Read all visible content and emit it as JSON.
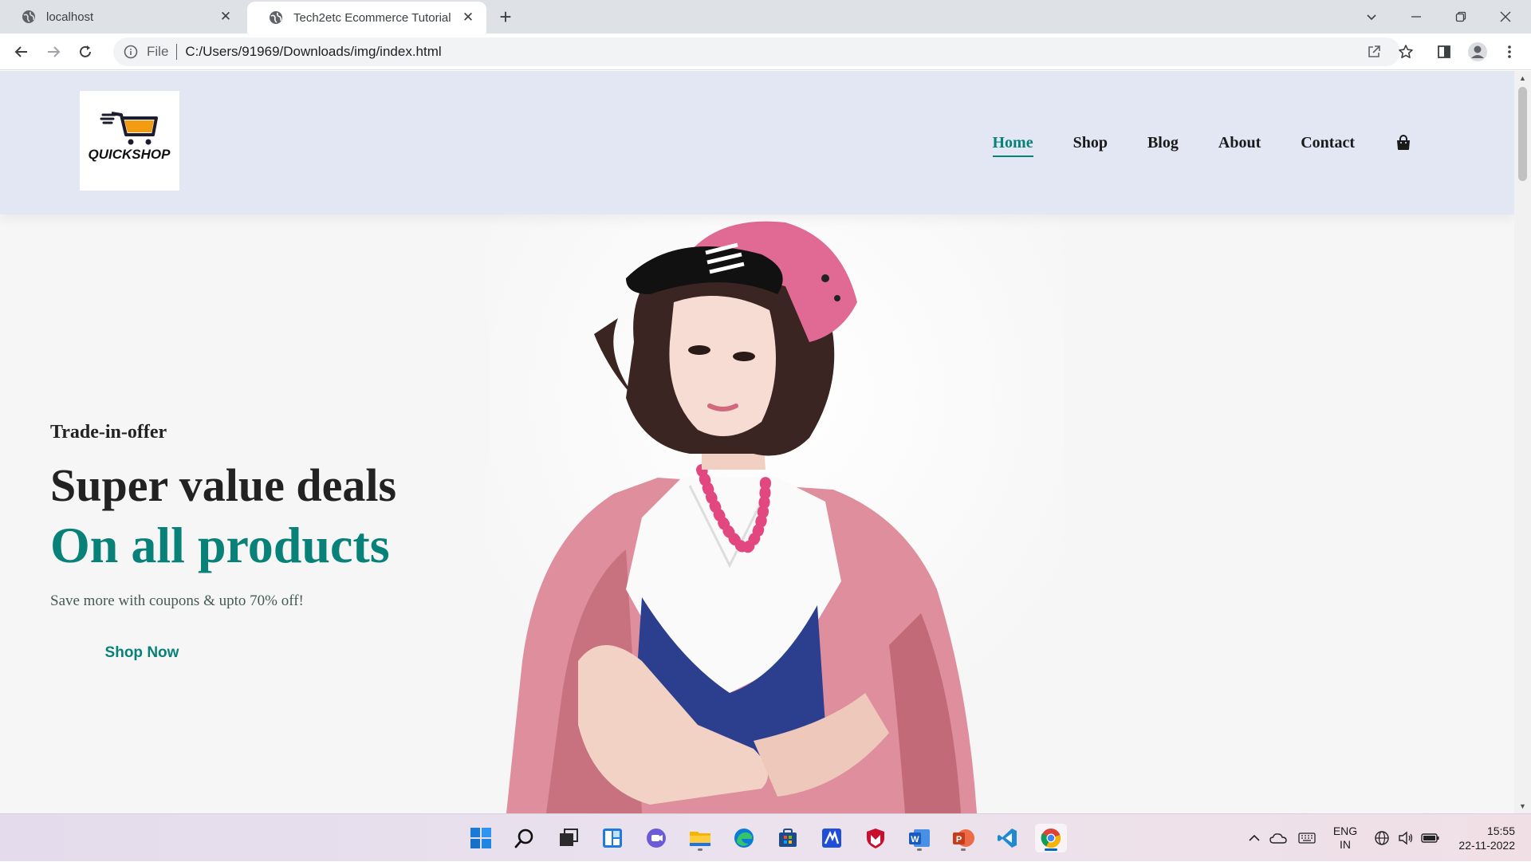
{
  "browser": {
    "tabs": [
      {
        "title": "localhost",
        "active": false
      },
      {
        "title": "Tech2etc Ecommerce Tutorial",
        "active": true
      }
    ],
    "address": {
      "scheme_label": "File",
      "url": "C:/Users/91969/Downloads/img/index.html"
    }
  },
  "site": {
    "logo_text": "QUICKSHOP",
    "nav": [
      {
        "label": "Home",
        "active": true
      },
      {
        "label": "Shop",
        "active": false
      },
      {
        "label": "Blog",
        "active": false
      },
      {
        "label": "About",
        "active": false
      },
      {
        "label": "Contact",
        "active": false
      }
    ],
    "hero": {
      "kicker": "Trade-in-offer",
      "headline": "Super value deals",
      "subheadline": "On all products",
      "description": "Save more with coupons & upto 70% off!",
      "cta": "Shop Now"
    },
    "colors": {
      "accent": "#088178",
      "header_bg": "#e3e6f3",
      "hero_bg": "#f6f6f6"
    }
  },
  "taskbar": {
    "apps": [
      "windows-start",
      "search",
      "task-view",
      "widgets",
      "teams-chat",
      "file-explorer",
      "edge",
      "microsoft-store",
      "mathpix",
      "mcafee",
      "word",
      "powerpoint",
      "vs-code",
      "chrome"
    ],
    "language": {
      "line1": "ENG",
      "line2": "IN"
    },
    "clock": {
      "time": "15:55",
      "date": "22-11-2022"
    }
  }
}
